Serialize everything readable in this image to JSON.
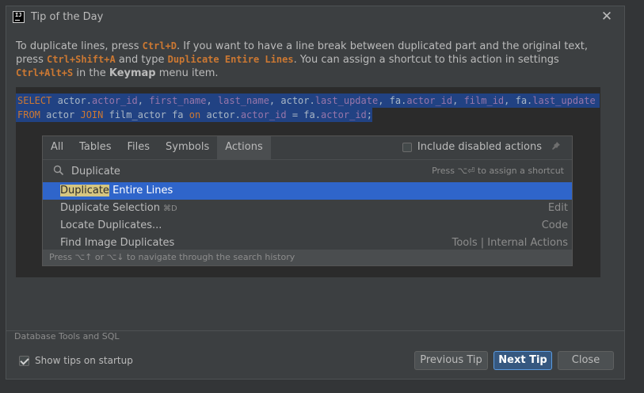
{
  "window": {
    "title": "Tip of the Day"
  },
  "tip": {
    "segments": [
      {
        "type": "text",
        "value": "To duplicate lines, press "
      },
      {
        "type": "kbd",
        "value": "Ctrl+D"
      },
      {
        "type": "text",
        "value": ". If you want to have a line break between duplicated part and the original text, press "
      },
      {
        "type": "kbd",
        "value": "Ctrl+Shift+A"
      },
      {
        "type": "text",
        "value": " and type "
      },
      {
        "type": "kbd",
        "value": "Duplicate Entire Lines"
      },
      {
        "type": "text",
        "value": ". You can assign a shortcut to this action in settings "
      },
      {
        "type": "kbd",
        "value": "Ctrl+Alt+S"
      },
      {
        "type": "text",
        "value": " in the "
      },
      {
        "type": "bold",
        "value": "Keymap"
      },
      {
        "type": "text",
        "value": " menu item."
      }
    ]
  },
  "code": {
    "line1": [
      {
        "c": "kw",
        "t": "SELECT "
      },
      {
        "c": "id",
        "t": "actor."
      },
      {
        "c": "fld",
        "t": "actor_id"
      },
      {
        "c": "id",
        "t": ", "
      },
      {
        "c": "fld",
        "t": "first_name"
      },
      {
        "c": "id",
        "t": ", "
      },
      {
        "c": "fld",
        "t": "last_name"
      },
      {
        "c": "id",
        "t": ", actor."
      },
      {
        "c": "fld",
        "t": "last_update"
      },
      {
        "c": "id",
        "t": ", fa."
      },
      {
        "c": "fld",
        "t": "actor_id"
      },
      {
        "c": "id",
        "t": ", "
      },
      {
        "c": "fld",
        "t": "film_id"
      },
      {
        "c": "id",
        "t": ", fa."
      },
      {
        "c": "fld",
        "t": "last_update"
      }
    ],
    "line2": [
      {
        "c": "kw",
        "t": "FROM "
      },
      {
        "c": "id",
        "t": "actor "
      },
      {
        "c": "kw",
        "t": "JOIN "
      },
      {
        "c": "id",
        "t": "film_actor fa "
      },
      {
        "c": "kw",
        "t": "on "
      },
      {
        "c": "id",
        "t": "actor."
      },
      {
        "c": "fld",
        "t": "actor_id"
      },
      {
        "c": "id",
        "t": " = fa."
      },
      {
        "c": "fld",
        "t": "actor_id"
      },
      {
        "c": "id",
        "t": ";"
      }
    ]
  },
  "popup": {
    "tabs": [
      "All",
      "Tables",
      "Files",
      "Symbols",
      "Actions"
    ],
    "active_tab": "Actions",
    "include_disabled_label": "Include disabled actions",
    "search_value": "Duplicate",
    "assign_hint": "Press ⌥⏎ to assign a shortcut",
    "results": [
      {
        "match": "Duplicate",
        "rest": " Entire Lines",
        "shortcut": "",
        "group": ""
      },
      {
        "match": "",
        "rest": "Duplicate Selection",
        "shortcut": "⌘D",
        "group": "Edit"
      },
      {
        "match": "",
        "rest": "Locate Duplicates...",
        "shortcut": "",
        "group": "Code"
      },
      {
        "match": "",
        "rest": "Find Image Duplicates",
        "shortcut": "",
        "group": "Tools | Internal Actions"
      }
    ],
    "footer_hint": "Press ⌥↑ or ⌥↓ to navigate through the search history"
  },
  "footer": {
    "source": "Database Tools and SQL",
    "show_tips_label": "Show tips on startup",
    "show_tips_checked": true,
    "prev_label": "Previous Tip",
    "next_label": "Next Tip",
    "close_label": "Close"
  },
  "colors": {
    "keyword": "#cc7832",
    "selection": "#214283",
    "list_selection": "#2f65ca",
    "highlight": "#d6c680",
    "default_button": "#365880"
  }
}
